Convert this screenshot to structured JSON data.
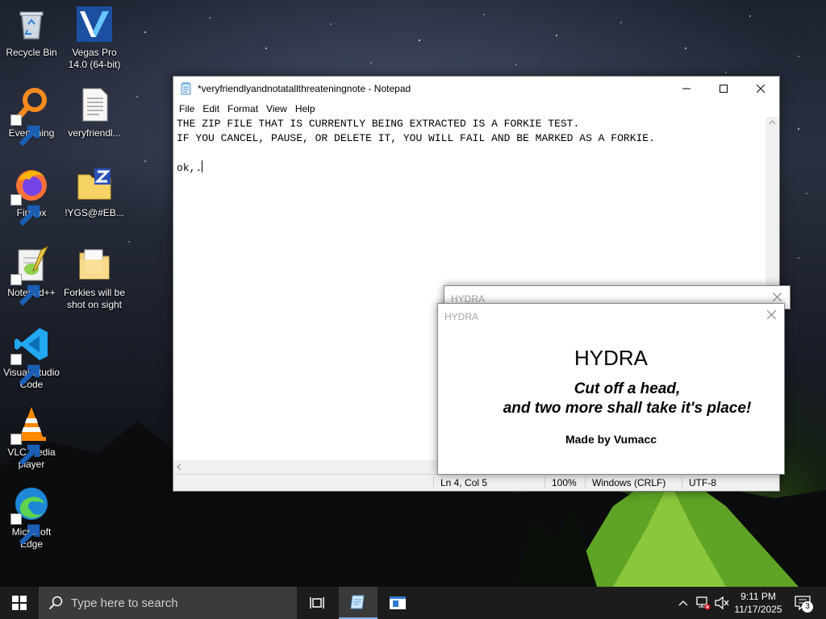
{
  "desktop": {
    "icons": [
      {
        "label": "Recycle Bin",
        "icon": "recycle-bin-icon"
      },
      {
        "label": "Vegas Pro 14.0 (64-bit)",
        "icon": "vegas-pro-icon"
      },
      {
        "label": "Everything",
        "icon": "everything-search-icon"
      },
      {
        "label": "veryfriendl...",
        "icon": "text-file-icon"
      },
      {
        "label": "Firefox",
        "icon": "firefox-icon"
      },
      {
        "label": "!YGS@#EB...",
        "icon": "zip-folder-icon"
      },
      {
        "label": "Notepad++",
        "icon": "notepad-plus-plus-icon"
      },
      {
        "label": "Forkies will be shot on sight",
        "icon": "folder-icon"
      },
      {
        "label": "Visual Studio Code",
        "icon": "vscode-icon"
      },
      {
        "label": "VLC media player",
        "icon": "vlc-icon"
      },
      {
        "label": "Microsoft Edge",
        "icon": "edge-icon"
      }
    ]
  },
  "notepad": {
    "title": "*veryfriendlyandnotatallthreateningnote - Notepad",
    "menu": [
      "File",
      "Edit",
      "Format",
      "View",
      "Help"
    ],
    "lines": [
      "THE ZIP FILE THAT IS CURRENTLY BEING EXTRACTED IS A FORKIE TEST.",
      "IF YOU CANCEL, PAUSE, OR DELETE IT, YOU WILL FAIL AND BE MARKED AS A FORKIE.",
      "",
      "ok,."
    ],
    "status": {
      "position": "Ln 4, Col 5",
      "zoom": "100%",
      "line_ending": "Windows (CRLF)",
      "encoding": "UTF-8"
    }
  },
  "hydra": {
    "window_title": "HYDRA",
    "heading": "HYDRA",
    "tagline_1": "Cut off a head,",
    "tagline_2": "and two more shall take it's place!",
    "credit": "Made by Vumacc"
  },
  "taskbar": {
    "search_placeholder": "Type here to search",
    "time": "9:11 PM",
    "date": "11/17/2025",
    "notification_count": "3"
  },
  "colors": {
    "taskbar_bg": "#1c1c1c",
    "search_bg": "#3b3b3b",
    "active_underline": "#7eb4ea",
    "hydra_title_text": "#a6a6a6"
  }
}
